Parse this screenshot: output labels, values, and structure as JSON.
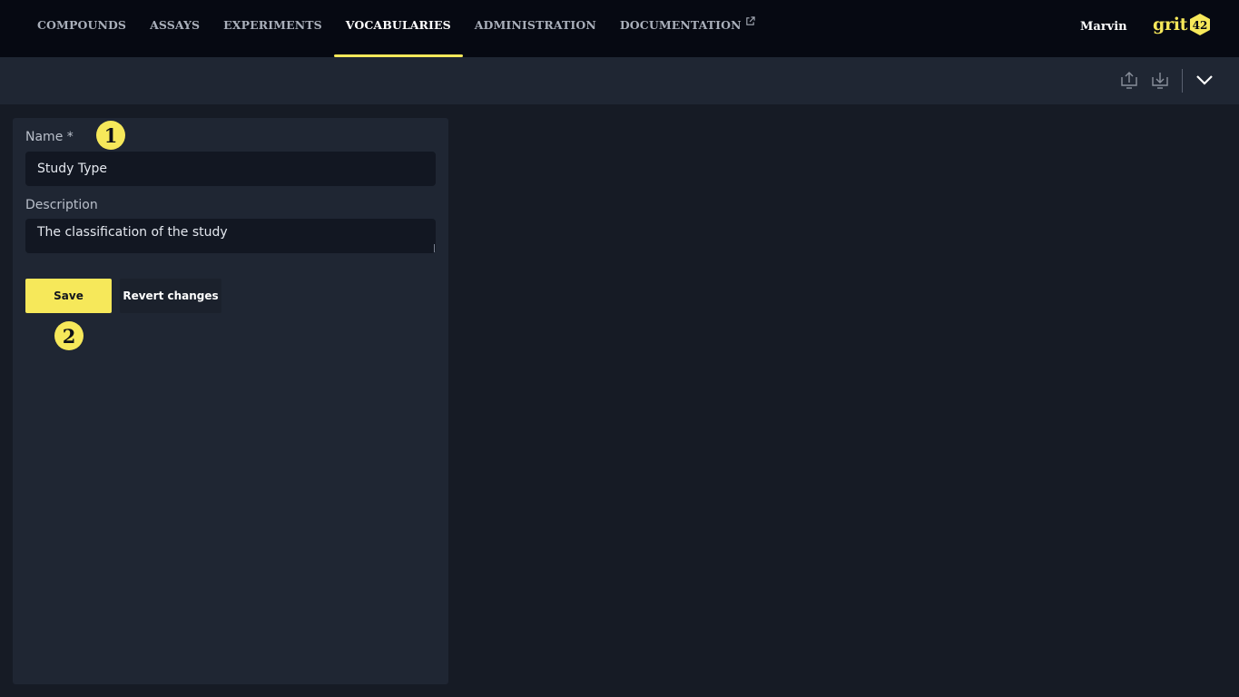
{
  "nav": {
    "items": [
      {
        "label": "COMPOUNDS"
      },
      {
        "label": "ASSAYS"
      },
      {
        "label": "EXPERIMENTS"
      },
      {
        "label": "VOCABULARIES",
        "active": true
      },
      {
        "label": "ADMINISTRATION"
      },
      {
        "label": "DOCUMENTATION",
        "external": true
      }
    ],
    "user": "Marvin",
    "logo_text": "grit",
    "logo_badge": "42"
  },
  "toolbar": {
    "icons": [
      "upload-icon",
      "download-icon",
      "chevron-down-icon"
    ]
  },
  "form": {
    "name_label": "Name *",
    "name_value": "Study Type",
    "description_label": "Description",
    "description_value": "The classification of the study",
    "save_label": "Save",
    "revert_label": "Revert changes"
  },
  "annotations": {
    "marker_1": "1",
    "marker_2": "2"
  },
  "colors": {
    "accent": "#f6e85a",
    "topbar_bg": "#060912",
    "page_bg": "#161b25",
    "panel_bg": "#1f2633",
    "input_bg": "#121722"
  }
}
